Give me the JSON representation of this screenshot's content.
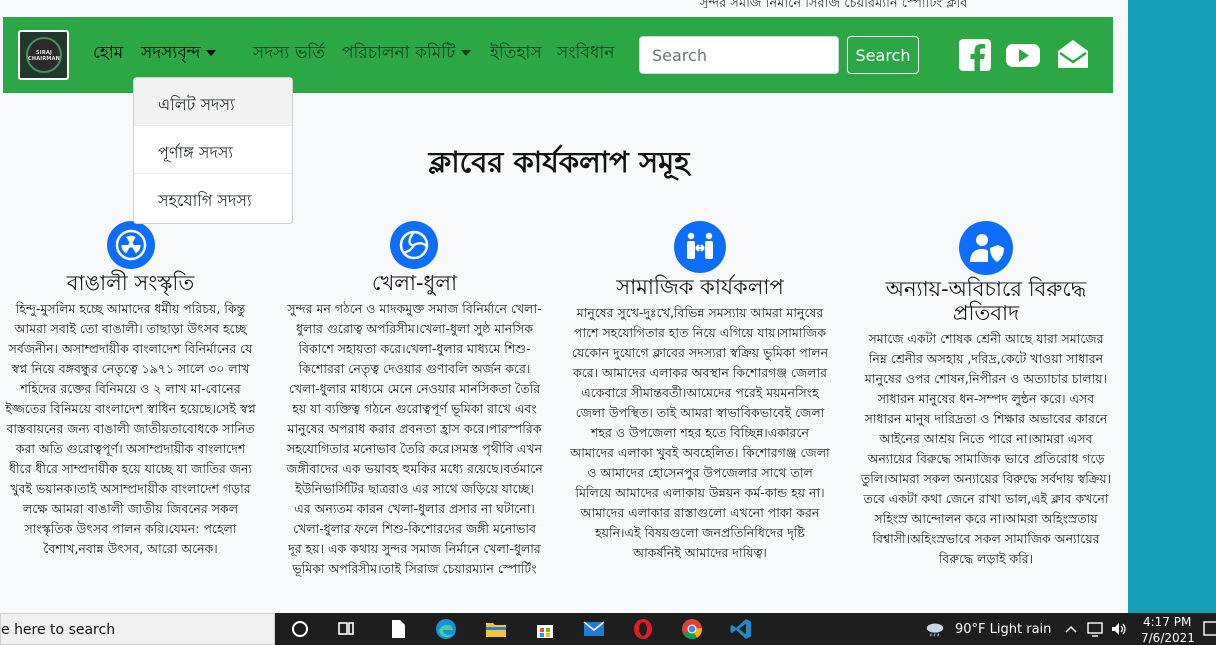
{
  "top_strip": "সুন্দর সমাজ নির্মানে সিরাজ চেয়ারম্যান স্পোর্টিং ক্লাব",
  "logo": {
    "text": "SIRAJ CHAIRMAN"
  },
  "nav": {
    "home": "হোম",
    "members": "সদস্যবৃন্দ",
    "membership": "সদস্য ভর্তি",
    "committee": "পরিচালনা কমিটি",
    "history": "ইতিহাস",
    "constitution": "সংবিধান"
  },
  "search": {
    "placeholder": "Search",
    "button": "Search"
  },
  "social": {
    "facebook": "facebook-icon",
    "youtube": "youtube-icon",
    "mail": "mail-icon"
  },
  "dropdown": [
    "এলিট সদস্য",
    "পূর্ণাঙ্গ সদস্য",
    "সহযোগি সদস্য"
  ],
  "section_title": "ক্লাবের কার্যকলাপ সমূহ",
  "activities": [
    {
      "icon": "radiation-icon",
      "title": "বাঙালী সংস্কৃতি",
      "text": "হিন্দু-মুসলিম হচ্ছে আমাদের ধর্মীয় পরিচয়, কিন্তু আমরা সবাই তো বাঙালী। তাছাড়া উৎসব হচ্ছে সর্বজনীন। অসাম্প্রদায়ীক বাংলাদেশ বিনির্মানের যে স্বপ্ন নিয়ে বঙ্গবন্ধুর নেতৃত্বে ১৯৭১ সালে ৩০ লাখ শহিদের রক্তের বিনিময়ে ও ২ লাখ মা-বোনের ইজ্জতের বিনিময়ে বাংলাদেশ স্বাধিন হয়েছে।সেই স্বপ্ন বাস্তবায়নের জন্য বাঙালী জাতীয়তাবোধকে সানিত করা অতি গুরোত্বপূর্ণ। অসাম্প্রদায়ীক বাংলাদেশ ধীরে ধীরে সাম্প্রদায়ীক হয়ে যাচ্ছে যা জাতির জন্য খুবই ভয়ানক।তাই অসাম্প্রদায়ীক বাংলাদেশ গড়ার লক্ষে আমরা বাঙালী জাতীয় জিবনের সকল সাংস্কৃতিক উৎসব পালন করি।যেমন: পহেলা বৈশাখ,নবান্ন উৎসব, আরো অনেক।"
    },
    {
      "icon": "volleyball-icon",
      "title": "খেলা-ধুলা",
      "text": "সুন্দর মন গঠনে ও মাদকমুক্ত সমাজ বিনির্মানে খেলা-ধুলার গুরোত্ব অপরিসীম।খেলা-ধুলা সুষ্ঠ মানসিক বিকাশে সহায়তা করে।খেলা-ধুলার মাধ্যমে শিশু-কিশোররা নেতৃত্ব দেওয়ার গুণাবলি অর্জন করে।খেলা-ধুলার মাধ্যমে মেনে নেওয়ার মানসিকতা তৈরি হয় যা ব্যক্তিত্ব গঠনে গুরোত্বপূর্ণ ভূমিকা রাখে এবং মানুষের অপরাধ করার প্রবনতা হ্রাস করে।পারস্পরিক সহযোগিতার মনোভাব তৈরি করে।সমস্ত পৃথীবি এখন জঙ্গীবাদের এক ভয়াবহ হুমকির মধ্যে রয়েছে।বর্তমানে ইউনিভার্সিটির ছাত্ররাও এর সাথে জড়িয়ে যাচ্ছে। এর অন্যতম কারন খেলা-ধুলার প্রসার না ঘটানো।খেলা-ধুলার ফলে শিশু-কিশোরদের জঙ্গী মনোভাব দূর হয়। এক কথায় সুন্দর সমাজ নির্মানে খেলা-ধুলার ভূমিকা অপরিসীম।তাই সিরাজ চেয়ারম্যান স্পোর্টিং"
    },
    {
      "icon": "people-arrows-icon",
      "title": "সামাজিক কার্যকলাপ",
      "text": "মানুষের সুখে-দুঃখে,বিভিন্ন সমস্যায় আমরা মানুষের পাশে সহযোগিতার হাত নিয়ে এগিয়ে যায়।সামাজিক যেকোন দুযোগে ক্লাবের সদস্যরা স্বক্রিয় ভুমিকা পালন করে। আমাদের এলাকর অবস্থান কিশোরগঞ্জ জেলার একেবারে সীমান্তবর্তী।আমেদের পরেই ময়মনসিংহ জেলা উপস্থিত। তাই আমরা স্বাভাবিকভাবেই জেলা শহর ও উপজেলা শহর হতে বিচ্ছিন্ন।একারনে আমাদের এলাকা খুবই অবহেলিত। কিশোরগঞ্জ জেলা ও আমাদের হোসেনপুর উপজেলার সাথে তাল মিলিয়ে আমাদের এলাকায় উন্নয়ন কর্ম-কান্ড হয় না। আমাদের এলাকার রাস্তাগুলো এখনো পাকা করন হয়নি।এই বিষয়গুলো জনপ্রতিনিধিদের দৃষ্টি আকর্ষনিই আমাদের দায়িত্ব।"
    },
    {
      "icon": "user-shield-icon",
      "title": "অন্যায়-অবিচারে বিরুদ্ধে প্রতিবাদ",
      "text": "সমাজে একটা শোষক শ্রেনী আছে যারা সমাজের নিম্ন শ্রেনীর অসহায় ,দরিদ্র,কেটে খাওয়া সাধারন মানুষের ওপর শোষন,নিপীরন ও অত্যাচার চালায়।সাধারন মানুষের ধন-সম্পদ লুন্ঠন করে। এসব সাধারন মানুষ দারিদ্রতা ও শিক্ষার অভাবের কারনে আইনের আশ্রয় নিতে পারে না।আমরা এসব অন্যায়ের বিরুদ্ধে সামাজিক ভাবে প্রতিরোধ গড়ে তুলি।আমরা সকল অন্যায়ের বিরুদ্ধে সর্বদায় স্বক্রিয়।তবে একটা কথা জেনে রাখা ভাল,এই ক্লাব কখনো সহিংস্র আন্দোলন করে না।আমরা অহিংস্রতায় বিশ্বাসী।অহিংস্রভাবে সকল সামাজিক অন্যায়ের বিরুদ্ধে লড়াই করি।"
    }
  ],
  "taskbar": {
    "search_text": "e here to search",
    "weather": "90°F  Light rain",
    "time": "4:17 PM",
    "date": "7/6/2021"
  }
}
